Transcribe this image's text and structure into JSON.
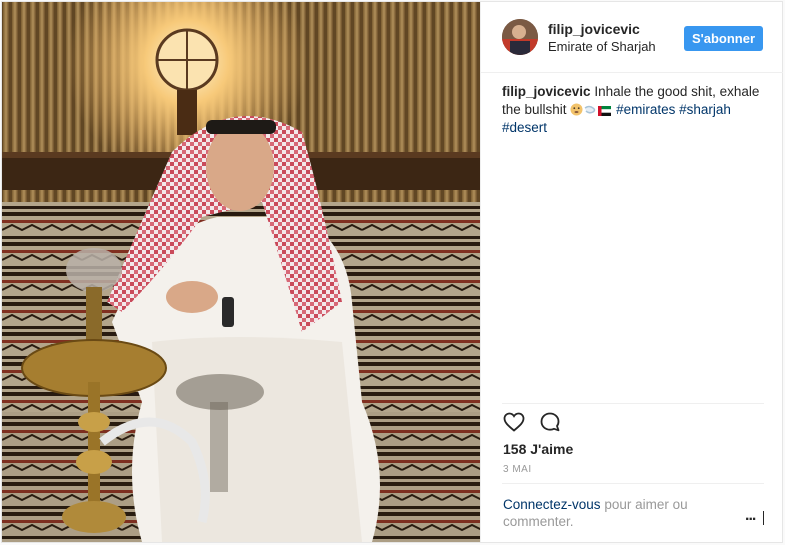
{
  "post": {
    "username": "filip_jovicevic",
    "location": "Emirate of Sharjah",
    "follow_label": "S'abonner",
    "caption": {
      "username": "filip_jovicevic",
      "text": "Inhale the good shit, exhale the bullshit",
      "hashtags": [
        "#emirates",
        "#sharjah",
        "#desert"
      ]
    },
    "likes": "158 J'aime",
    "date": "3 MAI",
    "comment_link": "Connectez-vous",
    "comment_rest": "pour aimer ou commenter.",
    "more_label": "..."
  },
  "icons": {
    "like": "heart-icon",
    "comment": "speech-bubble-icon",
    "caption_emojis": [
      "smoking-face-emoji",
      "dash-emoji",
      "uae-flag-emoji"
    ]
  },
  "colors": {
    "follow_button": "#3897f0",
    "link": "#003569",
    "muted": "#999999",
    "text": "#262626"
  }
}
